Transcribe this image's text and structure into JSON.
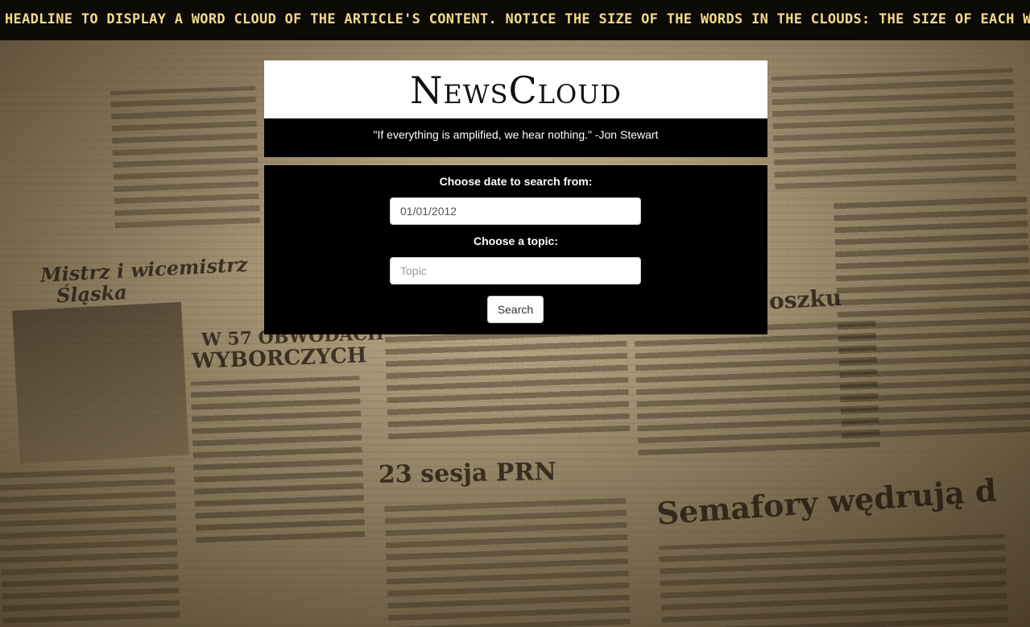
{
  "ticker": {
    "text": "HEADLINE TO DISPLAY A WORD CLOUD OF THE ARTICLE'S CONTENT. NOTICE THE SIZE OF THE WORDS IN THE CLOUDS: THE SIZE OF EACH W"
  },
  "brand": {
    "title": "NewsCloud"
  },
  "quote": {
    "text": "\"If everything is amplified, we hear nothing.\" -Jon Stewart"
  },
  "search": {
    "date_label": "Choose date to search from:",
    "date_value": "01/01/2012",
    "topic_label": "Choose a topic:",
    "topic_placeholder": "Topic",
    "button_label": "Search"
  },
  "background": {
    "headline_1": "Mistrz i wicemistrz",
    "headline_2": "Śląska",
    "headline_3": "W 57 OBWODACH",
    "headline_4": "WYBORCZYCH",
    "headline_5": "23 sesja PRN",
    "headline_6": "Semafory wędrują d",
    "headline_7": "oszku"
  },
  "colors": {
    "ticker_text": "#f3d98a",
    "ticker_bg": "#0c0a07",
    "panel_bg": "#000000",
    "brand_bg": "#ffffff"
  }
}
